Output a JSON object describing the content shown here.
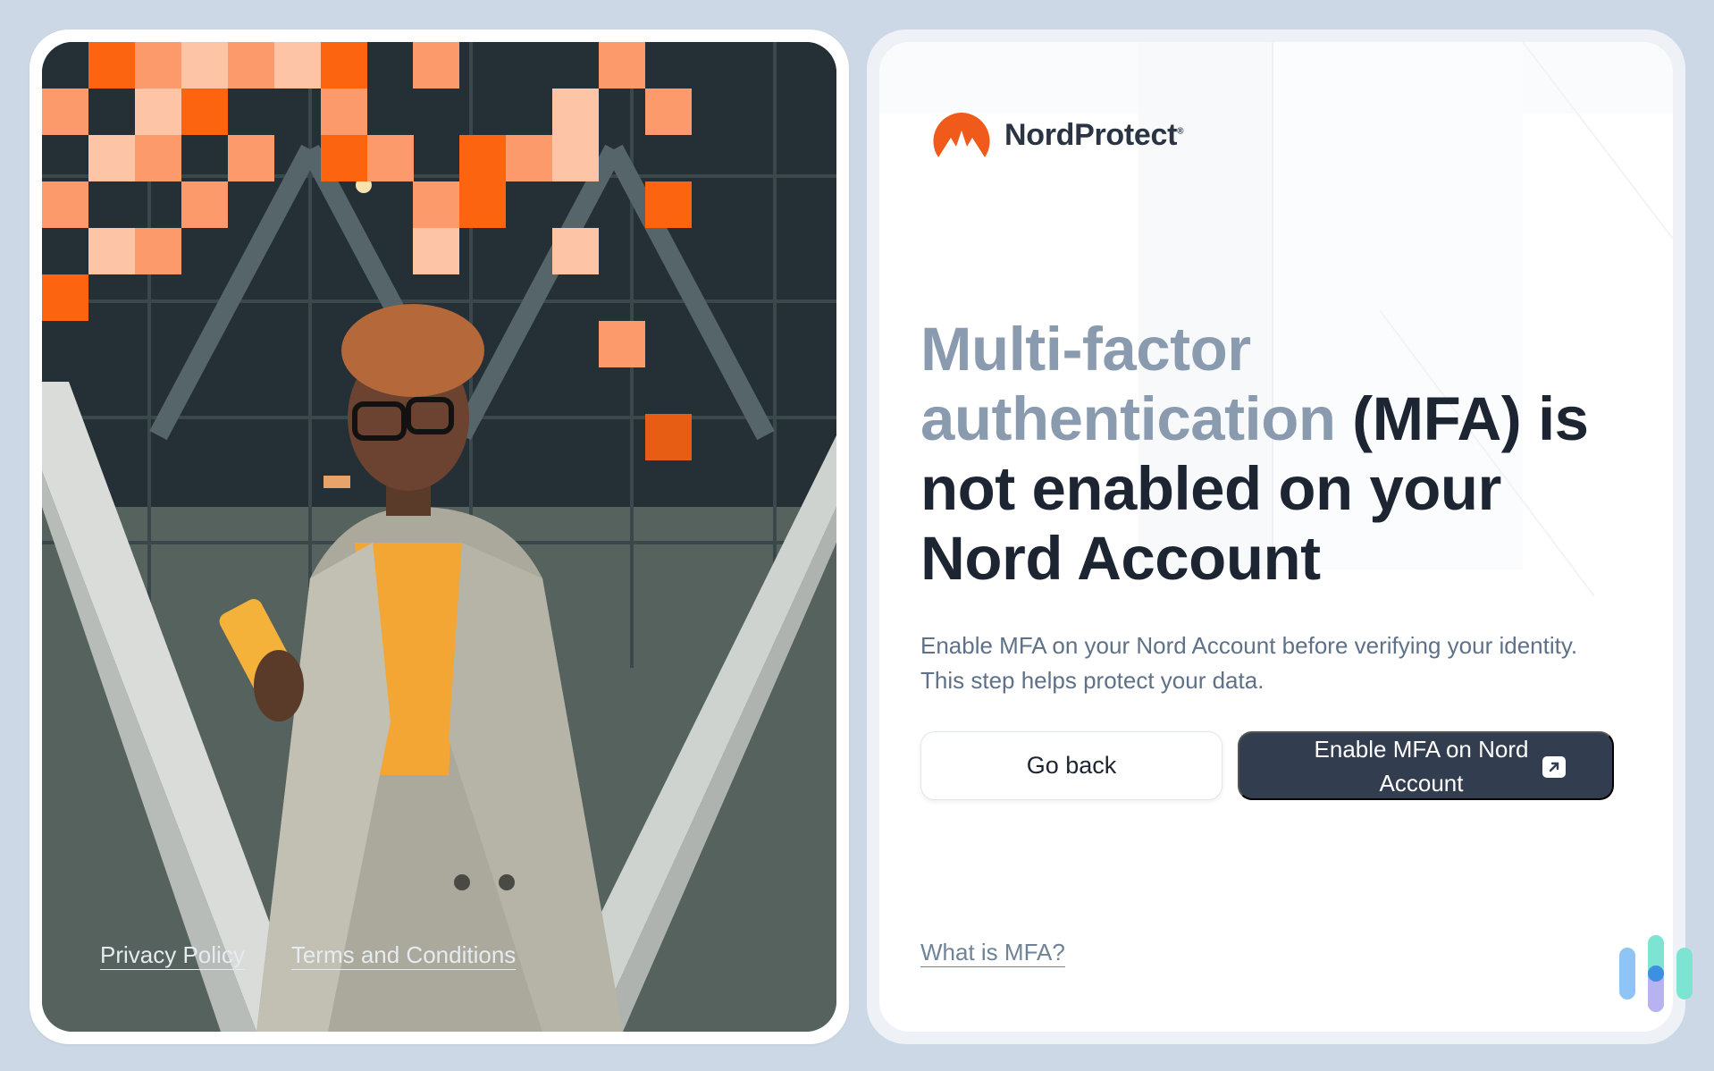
{
  "brand": {
    "name": "NordProtect",
    "reg_mark": "®",
    "accent": "#f05a1a",
    "dark": "#323d4f"
  },
  "footer": {
    "privacy_label": "Privacy Policy",
    "terms_label": "Terms and Conditions"
  },
  "main": {
    "headline_muted": "Multi-factor authentication",
    "headline_rest": " (MFA) is not enabled on your Nord Account",
    "subtitle": "Enable MFA on your Nord Account before verifying your identity. This step helps protect your data.",
    "back_label": "Go back",
    "enable_label": "Enable MFA on Nord Account",
    "enable_icon": "external-link-icon",
    "help_link": "What is MFA?"
  },
  "colors": {
    "headline_dark": "#1d2533",
    "headline_muted": "#8a9bb0",
    "body_text": "#5e7189",
    "page_bg": "#cdd8e6"
  }
}
